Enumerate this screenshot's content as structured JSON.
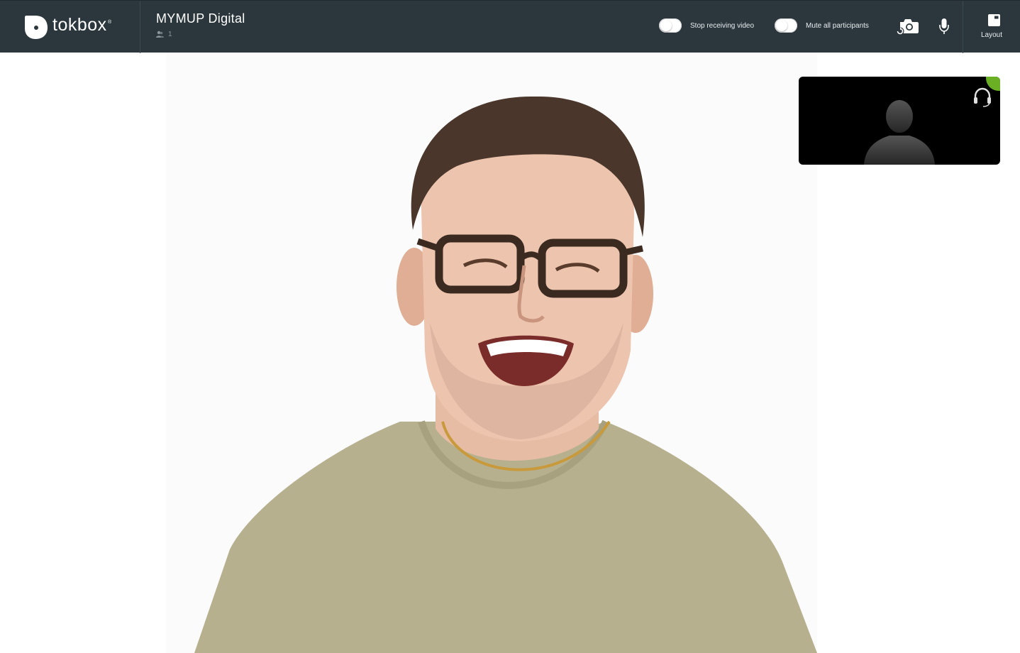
{
  "brand": {
    "name": "tokbox",
    "reg_mark": "®"
  },
  "session": {
    "title": "MYMUP Digital",
    "participant_count": "1"
  },
  "controls": {
    "stop_video_label": "Stop receiving video",
    "stop_video_on": false,
    "mute_all_label": "Mute all participants",
    "mute_all_on": false,
    "camera_icon": "camera-switch-icon",
    "mic_icon": "microphone-icon",
    "layout_label": "Layout",
    "layout_icon": "layout-icon"
  },
  "self_view": {
    "icon": "headset-icon",
    "placeholder": "avatar-silhouette",
    "status_color": "#6bb024"
  },
  "colors": {
    "topbar": "#2b363d",
    "accent_green": "#6bb024"
  }
}
